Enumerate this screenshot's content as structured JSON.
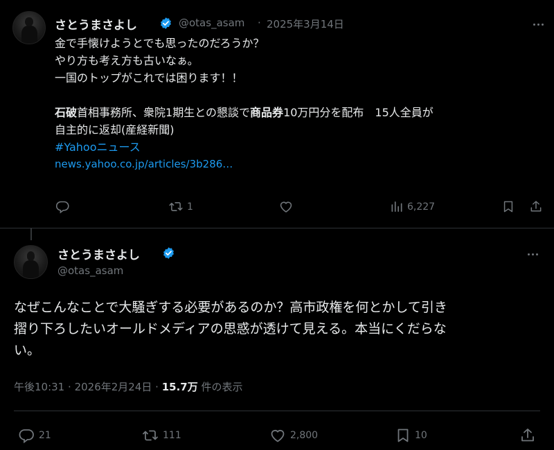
{
  "tweet1": {
    "display_name": "さとうまさよし",
    "handle": "@otas_asam",
    "separator": "·",
    "date": "2025年3月14日",
    "line1": "金で手懐けようとでも思ったのだろうか？",
    "line2": "やり方も考え方も古いなぁ。",
    "line3": "一国のトップがこれでは困ります！！",
    "article": {
      "bold1": "石破",
      "part1": "首相事務所、衆院1期生との懇談で",
      "bold2": "商品券",
      "part2": "10万円分を配布　15人全員が",
      "line2": "自主的に返却(産経新聞)"
    },
    "hashtag": "#Yahooニュース",
    "url": "news.yahoo.co.jp/articles/3b286…",
    "reply_count": "",
    "retweet_count": "1",
    "like_count": "",
    "view_count": "6,227"
  },
  "tweet2": {
    "display_name": "さとうまさよし",
    "handle": "@otas_asam",
    "line1": "なぜこんなことで大騒ぎする必要があるのか？高市政権を何とかして引き",
    "line2": "摺り下ろしたいオールドメディアの思惑が透けて見える。本当にくだらな",
    "line3": "い。",
    "time": "午後10:31",
    "separator": "·",
    "date": "2026年2月24日",
    "separator2": "·",
    "views_value": "15.7万",
    "views_label": "件の表示",
    "reply_count": "21",
    "retweet_count": "111",
    "like_count": "2,800",
    "bookmark_count": "10"
  },
  "colors": {
    "background": "#000000",
    "text": "#e7e9ea",
    "muted": "#71767b",
    "link": "#1d9bf0",
    "verified": "#1d9bf0",
    "divider": "#2f3336"
  },
  "icons": [
    "verified-badge-icon",
    "more-icon",
    "reply-icon",
    "retweet-icon",
    "like-icon",
    "views-icon",
    "bookmark-icon",
    "share-icon"
  ]
}
